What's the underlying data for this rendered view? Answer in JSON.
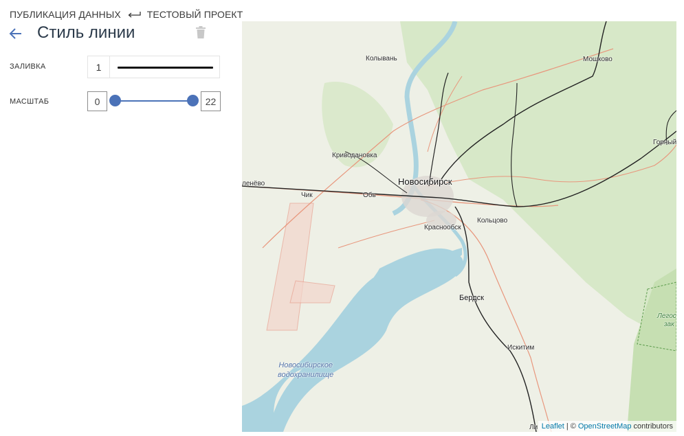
{
  "breadcrumb": {
    "items": [
      "ПУБЛИКАЦИЯ ДАННЫХ",
      "ТЕСТОВЫЙ ПРОЕКТ"
    ],
    "separator_icon": "return-arrow-icon"
  },
  "header": {
    "title": "Стиль линии",
    "back_icon": "arrow-left-icon",
    "delete_icon": "trash-icon"
  },
  "fill": {
    "label": "ЗАЛИВКА",
    "width_value": "1",
    "color": "#111111"
  },
  "scale": {
    "label": "МАСШТАБ",
    "min_value": "0",
    "max_value": "22",
    "accent": "#4b72b8"
  },
  "map": {
    "labels": {
      "kolyvan": "Колывань",
      "moshkovo": "Мошково",
      "gorny": "Горный",
      "krivodanovka": "Криводановка",
      "novosibirsk": "Новосибирск",
      "lenevo": "ленёво",
      "chik": "Чик",
      "ob": "Обь",
      "krasnoobsk": "Краснообск",
      "koltsovo": "Кольцово",
      "berdsk": "Бердск",
      "iskitim": "Искитим",
      "li": "Ли",
      "reservoir_line1": "Новосибирское",
      "reservoir_line2": "водохранилище",
      "reserve_line1": "Легос",
      "reserve_line2": "зак"
    },
    "attribution": {
      "leaflet": "Leaflet",
      "separator": "| ©",
      "osm": "OpenStreetMap",
      "contributors": "contributors"
    },
    "colors": {
      "land": "#eef0e6",
      "forest": "#d3e6c4",
      "water": "#aad3df",
      "road": "#e8967c",
      "rail": "#222222"
    }
  }
}
